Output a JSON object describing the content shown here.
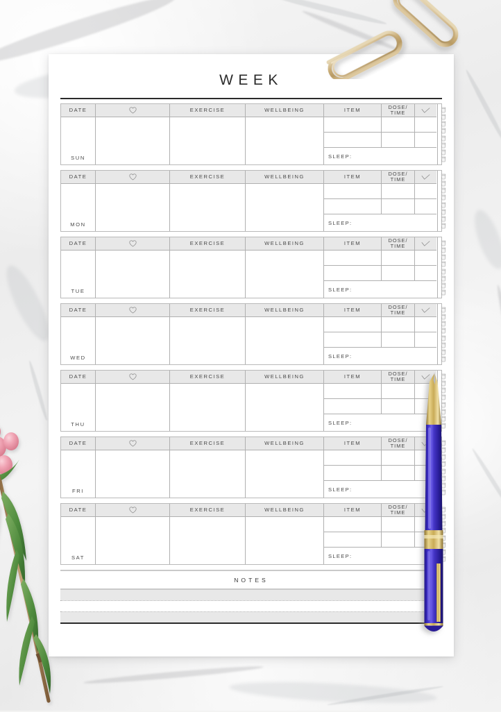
{
  "document": {
    "title": "WEEK",
    "type": "weekly-planner-printable"
  },
  "table": {
    "columns": [
      {
        "key": "date",
        "label": "DATE",
        "icon": null
      },
      {
        "key": "mood",
        "label": "",
        "icon": "heart-icon"
      },
      {
        "key": "exercise",
        "label": "EXERCISE",
        "icon": null
      },
      {
        "key": "wellbeing",
        "label": "WELLBEING",
        "icon": null
      },
      {
        "key": "item",
        "label": "ITEM",
        "icon": null
      },
      {
        "key": "dose_time",
        "label": "DOSE/\nTIME",
        "label_line1": "DOSE/",
        "label_line2": "TIME",
        "icon": null
      },
      {
        "key": "done",
        "label": "",
        "icon": "check-icon"
      },
      {
        "key": "water",
        "label": "",
        "icon": "water-glass-icon"
      }
    ],
    "sleep_label": "SLEEP:",
    "water_glasses_per_day": 8,
    "medication_rows_per_day": 2
  },
  "days": [
    {
      "abbr": "SUN",
      "date_value": "",
      "mood_value": "",
      "exercise_value": "",
      "wellbeing_value": "",
      "sleep_value": "",
      "meds": [
        {
          "item": "",
          "dose_time": "",
          "done": ""
        },
        {
          "item": "",
          "dose_time": "",
          "done": ""
        }
      ]
    },
    {
      "abbr": "MON",
      "date_value": "",
      "mood_value": "",
      "exercise_value": "",
      "wellbeing_value": "",
      "sleep_value": "",
      "meds": [
        {
          "item": "",
          "dose_time": "",
          "done": ""
        },
        {
          "item": "",
          "dose_time": "",
          "done": ""
        }
      ]
    },
    {
      "abbr": "TUE",
      "date_value": "",
      "mood_value": "",
      "exercise_value": "",
      "wellbeing_value": "",
      "sleep_value": "",
      "meds": [
        {
          "item": "",
          "dose_time": "",
          "done": ""
        },
        {
          "item": "",
          "dose_time": "",
          "done": ""
        }
      ]
    },
    {
      "abbr": "WED",
      "date_value": "",
      "mood_value": "",
      "exercise_value": "",
      "wellbeing_value": "",
      "sleep_value": "",
      "meds": [
        {
          "item": "",
          "dose_time": "",
          "done": ""
        },
        {
          "item": "",
          "dose_time": "",
          "done": ""
        }
      ]
    },
    {
      "abbr": "THU",
      "date_value": "",
      "mood_value": "",
      "exercise_value": "",
      "wellbeing_value": "",
      "sleep_value": "",
      "meds": [
        {
          "item": "",
          "dose_time": "",
          "done": ""
        },
        {
          "item": "",
          "dose_time": "",
          "done": ""
        }
      ]
    },
    {
      "abbr": "FRI",
      "date_value": "",
      "mood_value": "",
      "exercise_value": "",
      "wellbeing_value": "",
      "sleep_value": "",
      "meds": [
        {
          "item": "",
          "dose_time": "",
          "done": ""
        },
        {
          "item": "",
          "dose_time": "",
          "done": ""
        }
      ]
    },
    {
      "abbr": "SAT",
      "date_value": "",
      "mood_value": "",
      "exercise_value": "",
      "wellbeing_value": "",
      "sleep_value": "",
      "meds": [
        {
          "item": "",
          "dose_time": "",
          "done": ""
        },
        {
          "item": "",
          "dose_time": "",
          "done": ""
        }
      ]
    }
  ],
  "notes": {
    "title": "NOTES",
    "lines": [
      "",
      "",
      "",
      ""
    ]
  },
  "props": [
    {
      "name": "paperclip-pair",
      "description": "two gold paperclips",
      "color": "#c8b184"
    },
    {
      "name": "ballpoint-pen",
      "description": "blue pen with gold trim",
      "color": "#3a2fb8"
    },
    {
      "name": "flower-sprig",
      "description": "pink flower buds with green leaves",
      "color": "#eda3b0"
    }
  ],
  "colors": {
    "paper": "#ffffff",
    "header_fill": "#e8e8e8",
    "rule_dark": "#2a2a2a",
    "rule_light": "#b0b0b0",
    "text": "#4a4a4a",
    "background": "#efefef"
  }
}
